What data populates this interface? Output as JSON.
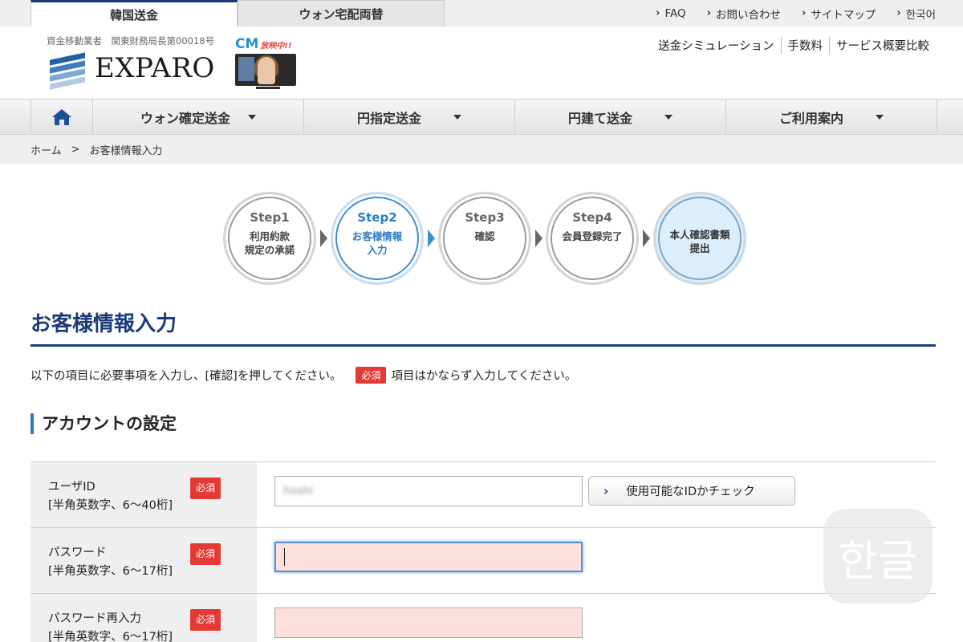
{
  "top_tabs": [
    "韓国送金",
    "ウォン宅配両替"
  ],
  "top_links": [
    "FAQ",
    "お問い合わせ",
    "サイトマップ",
    "한국어"
  ],
  "header": {
    "license": "資金移動業者　関東財務局長第00018号",
    "logo_text": "EXPARO",
    "cm_label": "CM",
    "cm_badge": "放映中!!",
    "links": [
      "送金シミュレーション",
      "手数料",
      "サービス概要比較"
    ]
  },
  "nav": {
    "items": [
      "ウォン確定送金",
      "円指定送金",
      "円建て送金",
      "ご利用案内"
    ]
  },
  "breadcrumb": {
    "home": "ホーム",
    "separator": ">",
    "current": "お客様情報入力"
  },
  "steps": [
    {
      "num": "Step1",
      "label": "利用約款\n規定の承諾"
    },
    {
      "num": "Step2",
      "label": "お客様情報\n入力"
    },
    {
      "num": "Step3",
      "label": "確認"
    },
    {
      "num": "Step4",
      "label": "会員登録完了"
    },
    {
      "num": "",
      "label": "本人確認書類\n提出"
    }
  ],
  "page": {
    "title": "お客様情報入力",
    "intro_before": "以下の項目に必要事項を入力し、[確認]を押してください。",
    "required_badge": "必須",
    "intro_after": "項目はかならず入力してください。",
    "section_title": "アカウントの設定"
  },
  "form": {
    "rows": [
      {
        "label": "ユーザID",
        "hint": "[半角英数字、6〜40桁]",
        "value": "hoshi"
      },
      {
        "label": "パスワード",
        "hint": "[半角英数字、6〜17桁]",
        "value": ""
      },
      {
        "label": "パスワード再入力",
        "hint": "[半角英数字、6〜17桁]",
        "value": ""
      }
    ],
    "check_button": "使用可能なIDかチェック"
  },
  "watermark": "한글",
  "colors": {
    "brand_navy": "#1b3a78",
    "accent_blue": "#2b7bc4",
    "required_red": "#e33a36",
    "error_pink": "#fde0de"
  }
}
